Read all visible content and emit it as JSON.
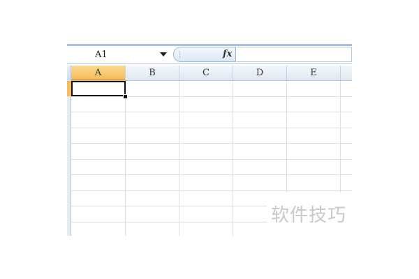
{
  "formula_bar": {
    "name_box_value": "A1",
    "fx_label": "fx",
    "formula_value": ""
  },
  "columns": [
    "A",
    "B",
    "C",
    "D",
    "E"
  ],
  "selected_column": "A",
  "active_cell": "A1",
  "watermark_text": "软件技巧",
  "colors": {
    "selected_header": "#f5bd5e",
    "gridline": "#dadfe6",
    "header_border": "#b4c6dc"
  }
}
